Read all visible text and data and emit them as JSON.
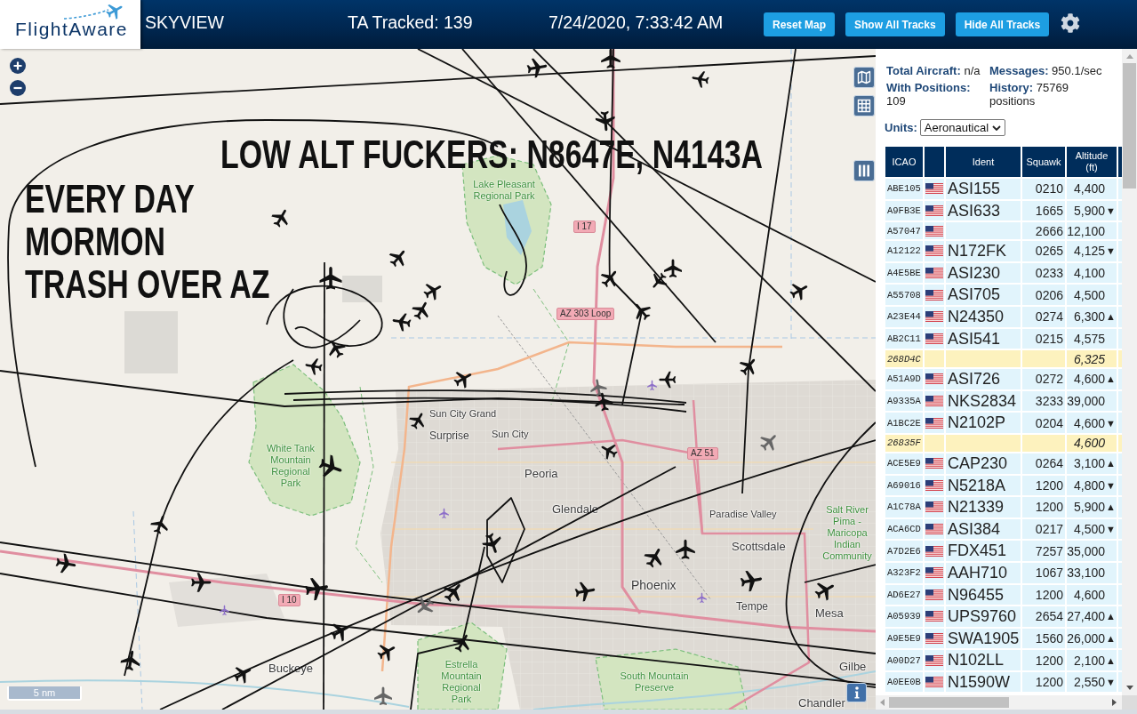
{
  "header": {
    "logo": "FlightAware",
    "title": "SKYVIEW",
    "tracked": "TA Tracked: 139",
    "datetime": "7/24/2020, 7:33:42 AM",
    "buttons": [
      "Reset Map",
      "Show All Tracks",
      "Hide All Tracks"
    ]
  },
  "map": {
    "annotations": [
      {
        "lines": [
          "LOW ALT FUCKERS: N8647E, N4143A"
        ]
      },
      {
        "lines": [
          "EVERY DAY",
          "MORMON",
          "TRASH OVER AZ"
        ]
      }
    ],
    "labels": [
      {
        "text": "Lake Pleasant Regional Park",
        "kind": "park"
      },
      {
        "text": "I 17",
        "kind": "road"
      },
      {
        "text": "AZ 303 Loop",
        "kind": "road"
      },
      {
        "text": "Sun City Grand",
        "kind": "city"
      },
      {
        "text": "Surprise",
        "kind": "city"
      },
      {
        "text": "Sun City",
        "kind": "city"
      },
      {
        "text": "White Tank Mountain Regional Park",
        "kind": "park"
      },
      {
        "text": "AZ 51",
        "kind": "road"
      },
      {
        "text": "Peoria",
        "kind": "city"
      },
      {
        "text": "Glendale",
        "kind": "city"
      },
      {
        "text": "Paradise Valley",
        "kind": "city"
      },
      {
        "text": "Salt River Pima - Maricopa Indian Community",
        "kind": "park"
      },
      {
        "text": "Scottsdale",
        "kind": "city"
      },
      {
        "text": "Phoenix",
        "kind": "city"
      },
      {
        "text": "I 10",
        "kind": "road"
      },
      {
        "text": "Tempe",
        "kind": "city"
      },
      {
        "text": "Mesa",
        "kind": "city"
      },
      {
        "text": "Buckeye",
        "kind": "city"
      },
      {
        "text": "Estrella Mountain Regional Park",
        "kind": "park"
      },
      {
        "text": "South Mountain Preserve",
        "kind": "park"
      },
      {
        "text": "Gilbe",
        "kind": "city"
      },
      {
        "text": "Chandler",
        "kind": "city"
      }
    ],
    "aircraft": [
      {
        "faded": false
      },
      {
        "faded": false
      },
      {
        "faded": false
      },
      {
        "faded": false
      },
      {
        "faded": false
      },
      {
        "faded": false
      },
      {
        "faded": false
      },
      {
        "faded": false
      },
      {
        "faded": false
      },
      {
        "faded": false
      },
      {
        "faded": false
      },
      {
        "faded": false
      },
      {
        "faded": false
      },
      {
        "faded": false
      },
      {
        "faded": false
      },
      {
        "faded": false
      },
      {
        "faded": false
      },
      {
        "faded": false
      },
      {
        "faded": false
      },
      {
        "faded": false
      },
      {
        "faded": true
      },
      {
        "faded": false
      },
      {
        "faded": false
      },
      {
        "faded": true
      },
      {
        "faded": false
      },
      {
        "faded": false
      },
      {
        "faded": false
      },
      {
        "faded": false
      },
      {
        "faded": false
      },
      {
        "faded": false
      },
      {
        "faded": false
      },
      {
        "faded": false
      },
      {
        "faded": false
      },
      {
        "faded": false
      },
      {
        "faded": false
      },
      {
        "faded": true
      },
      {
        "faded": false
      },
      {
        "faded": false
      },
      {
        "faded": false
      },
      {
        "faded": false
      },
      {
        "faded": false
      },
      {
        "faded": false
      },
      {
        "faded": false
      },
      {
        "faded": true
      }
    ],
    "scale": "5 nm"
  },
  "panel": {
    "stats": [
      "**Total Aircraft:** n/a",
      "**Messages:** 950.1/sec",
      "**With Positions:** 109",
      "**History:** 75769 positions"
    ],
    "units": {
      "label": "Units:",
      "value": "Aeronautical"
    }
  },
  "table": {
    "columns": [
      "ICAO",
      "Ident",
      "Squawk",
      "Altitude (ft)"
    ],
    "rows": [
      {
        "icao": "ABE105",
        "kind": "adsb",
        "ident": "ASI155",
        "squawk": "0210",
        "altitude": "4,400"
      },
      {
        "icao": "A9FB3E",
        "kind": "adsb",
        "ident": "ASI633",
        "squawk": "1665",
        "altitude": "5,900",
        "trend": "▼"
      },
      {
        "icao": "A57047",
        "kind": "adsb",
        "squawk": "2666",
        "altitude": "12,100"
      },
      {
        "icao": "A12122",
        "kind": "adsb",
        "ident": "N172FK",
        "squawk": "0265",
        "altitude": "4,125",
        "trend": "▼"
      },
      {
        "icao": "A4E5BE",
        "kind": "adsb",
        "ident": "ASI230",
        "squawk": "0233",
        "altitude": "4,100"
      },
      {
        "icao": "A55708",
        "kind": "adsb",
        "ident": "ASI705",
        "squawk": "0206",
        "altitude": "4,500"
      },
      {
        "icao": "A23E44",
        "kind": "adsb",
        "ident": "N24350",
        "squawk": "0274",
        "altitude": "6,300",
        "trend": "▲"
      },
      {
        "icao": "AB2C11",
        "kind": "adsb",
        "ident": "ASI541",
        "squawk": "0215",
        "altitude": "4,575"
      },
      {
        "icao": "268D4C",
        "kind": "tisb",
        "altitude": "6,325"
      },
      {
        "icao": "A51A9D",
        "kind": "adsb",
        "ident": "ASI726",
        "squawk": "0272",
        "altitude": "4,600",
        "trend": "▲"
      },
      {
        "icao": "A9335A",
        "kind": "adsb",
        "ident": "NKS2834",
        "squawk": "3233",
        "altitude": "39,000"
      },
      {
        "icao": "A1BC2E",
        "kind": "adsb",
        "ident": "N2102P",
        "squawk": "0204",
        "altitude": "4,600",
        "trend": "▼"
      },
      {
        "icao": "26835F",
        "kind": "tisb",
        "altitude": "4,600"
      },
      {
        "icao": "ACE5E9",
        "kind": "adsb",
        "ident": "CAP230",
        "squawk": "0264",
        "altitude": "3,100",
        "trend": "▲"
      },
      {
        "icao": "A69016",
        "kind": "adsb",
        "ident": "N5218A",
        "squawk": "1200",
        "altitude": "4,800",
        "trend": "▼"
      },
      {
        "icao": "A1C78A",
        "kind": "adsb",
        "ident": "N21339",
        "squawk": "1200",
        "altitude": "5,900",
        "trend": "▲"
      },
      {
        "icao": "ACA6CD",
        "kind": "adsb",
        "ident": "ASI384",
        "squawk": "0217",
        "altitude": "4,500",
        "trend": "▼"
      },
      {
        "icao": "A7D2E6",
        "kind": "adsb",
        "ident": "FDX451",
        "squawk": "7257",
        "altitude": "35,000"
      },
      {
        "icao": "A323F2",
        "kind": "adsb",
        "ident": "AAH710",
        "squawk": "1067",
        "altitude": "33,100"
      },
      {
        "icao": "AD6E27",
        "kind": "adsb",
        "ident": "N96455",
        "squawk": "1200",
        "altitude": "4,600"
      },
      {
        "icao": "A05939",
        "kind": "adsb",
        "ident": "UPS9760",
        "squawk": "2654",
        "altitude": "27,400",
        "trend": "▲"
      },
      {
        "icao": "A9E5E9",
        "kind": "adsb",
        "ident": "SWA1905",
        "squawk": "1560",
        "altitude": "26,000",
        "trend": "▲"
      },
      {
        "icao": "A00D27",
        "kind": "adsb",
        "ident": "N102LL",
        "squawk": "1200",
        "altitude": "2,100",
        "trend": "▲"
      },
      {
        "icao": "A0EE0B",
        "kind": "adsb",
        "ident": "N1590W",
        "squawk": "1200",
        "altitude": "2,550",
        "trend": "▼"
      }
    ]
  }
}
